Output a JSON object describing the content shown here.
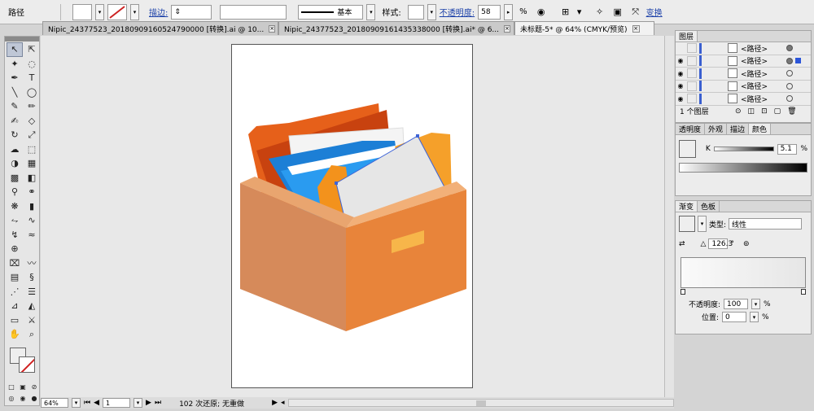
{
  "control_bar": {
    "selection_label": "路径",
    "stroke_label": "描边:",
    "brush_label": "基本",
    "style_label": "样式:",
    "opacity_label": "不透明度:",
    "opacity_value": "58",
    "percent": "%",
    "transform_label": "变换"
  },
  "tabs": [
    {
      "label": "Nipic_24377523_20180909160524790000 [转换].ai @ 10..."
    },
    {
      "label": "Nipic_24377523_20180909161435338000 [转换].ai* @ 6..."
    },
    {
      "label": "未标题-5* @ 64% (CMYK/预览)"
    }
  ],
  "layers_panel": {
    "title": "图层",
    "items": [
      {
        "name": "<路径>"
      },
      {
        "name": "<路径>"
      },
      {
        "name": "<路径>"
      },
      {
        "name": "<路径>"
      },
      {
        "name": "<路径>"
      }
    ],
    "footer": "1 个图层"
  },
  "color_panel": {
    "tabs": [
      "透明度",
      "外观",
      "描边",
      "颜色"
    ],
    "k_label": "K",
    "k_value": "5.1",
    "percent": "%"
  },
  "gradient_panel": {
    "tabs": [
      "渐变",
      "色板"
    ],
    "type_label": "类型:",
    "type_value": "线性",
    "angle_value": "126.3",
    "degree": "°",
    "opacity_label": "不透明度:",
    "opacity_value": "100",
    "position_label": "位置:",
    "position_value": "0",
    "percent": "%"
  },
  "status_bar": {
    "zoom": "64%",
    "page": "1",
    "status_text": "102 次还原; 无重做"
  },
  "colors": {
    "box_front": "#e8843a",
    "box_side": "#d48a5a",
    "orange_folder": "#f28a1e",
    "blue_folder": "#1f8fe0"
  }
}
